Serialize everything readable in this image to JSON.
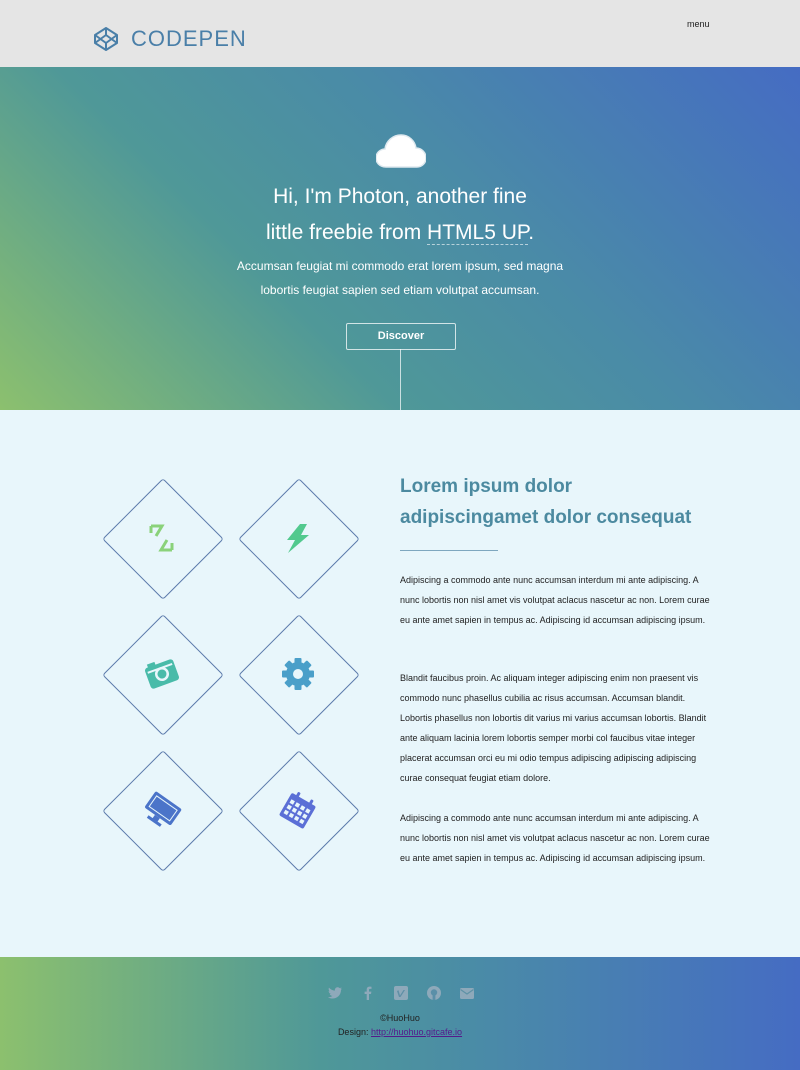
{
  "header": {
    "brand": "CODEPEN",
    "menu_label": "menu"
  },
  "hero": {
    "title_line1": "Hi, I'm Photon, another fine",
    "title_line2_prefix": "little freebie from ",
    "title_link": "HTML5 UP",
    "title_line2_suffix": ".",
    "subtitle_line1": "Accumsan feugiat mi commodo erat lorem ipsum, sed magna",
    "subtitle_line2": "lobortis feugiat sapien sed etiam volutpat accumsan.",
    "button_label": "Discover"
  },
  "features": {
    "icons": [
      "code-icon",
      "bolt-icon",
      "camera-icon",
      "cog-icon",
      "desktop-icon",
      "calendar-icon"
    ],
    "colors": [
      "#8ad27a",
      "#52c98e",
      "#49bba9",
      "#4a9fc9",
      "#4b74c9",
      "#5b6fd6"
    ]
  },
  "content": {
    "heading_line1": "Lorem ipsum dolor",
    "heading_line2": "adipiscingamet dolor consequat",
    "paragraphs": [
      "Adipiscing a commodo ante nunc accumsan interdum mi ante adipiscing. A nunc lobortis non nisl amet vis volutpat aclacus nascetur ac non. Lorem curae eu ante amet sapien in tempus ac. Adipiscing id accumsan adipiscing ipsum.",
      "Blandit faucibus proin. Ac aliquam integer adipiscing enim non praesent vis commodo nunc phasellus cubilia ac risus accumsan. Accumsan blandit. Lobortis phasellus non lobortis dit varius mi varius accumsan lobortis. Blandit ante aliquam lacinia lorem lobortis semper morbi col faucibus vitae integer placerat accumsan orci eu mi odio tempus adipiscing adipiscing adipiscing curae consequat feugiat etiam dolore.",
      "Adipiscing a commodo ante nunc accumsan interdum mi ante adipiscing. A nunc lobortis non nisl amet vis volutpat aclacus nascetur ac non. Lorem curae eu ante amet sapien in tempus ac. Adipiscing id accumsan adipiscing ipsum."
    ]
  },
  "footer": {
    "social": [
      "twitter-icon",
      "facebook-icon",
      "vimeo-icon",
      "github-icon",
      "envelope-icon"
    ],
    "copyright": "©HuoHuo",
    "design_label": "Design: ",
    "design_link": "http://huohuo.gitcafe.io"
  }
}
